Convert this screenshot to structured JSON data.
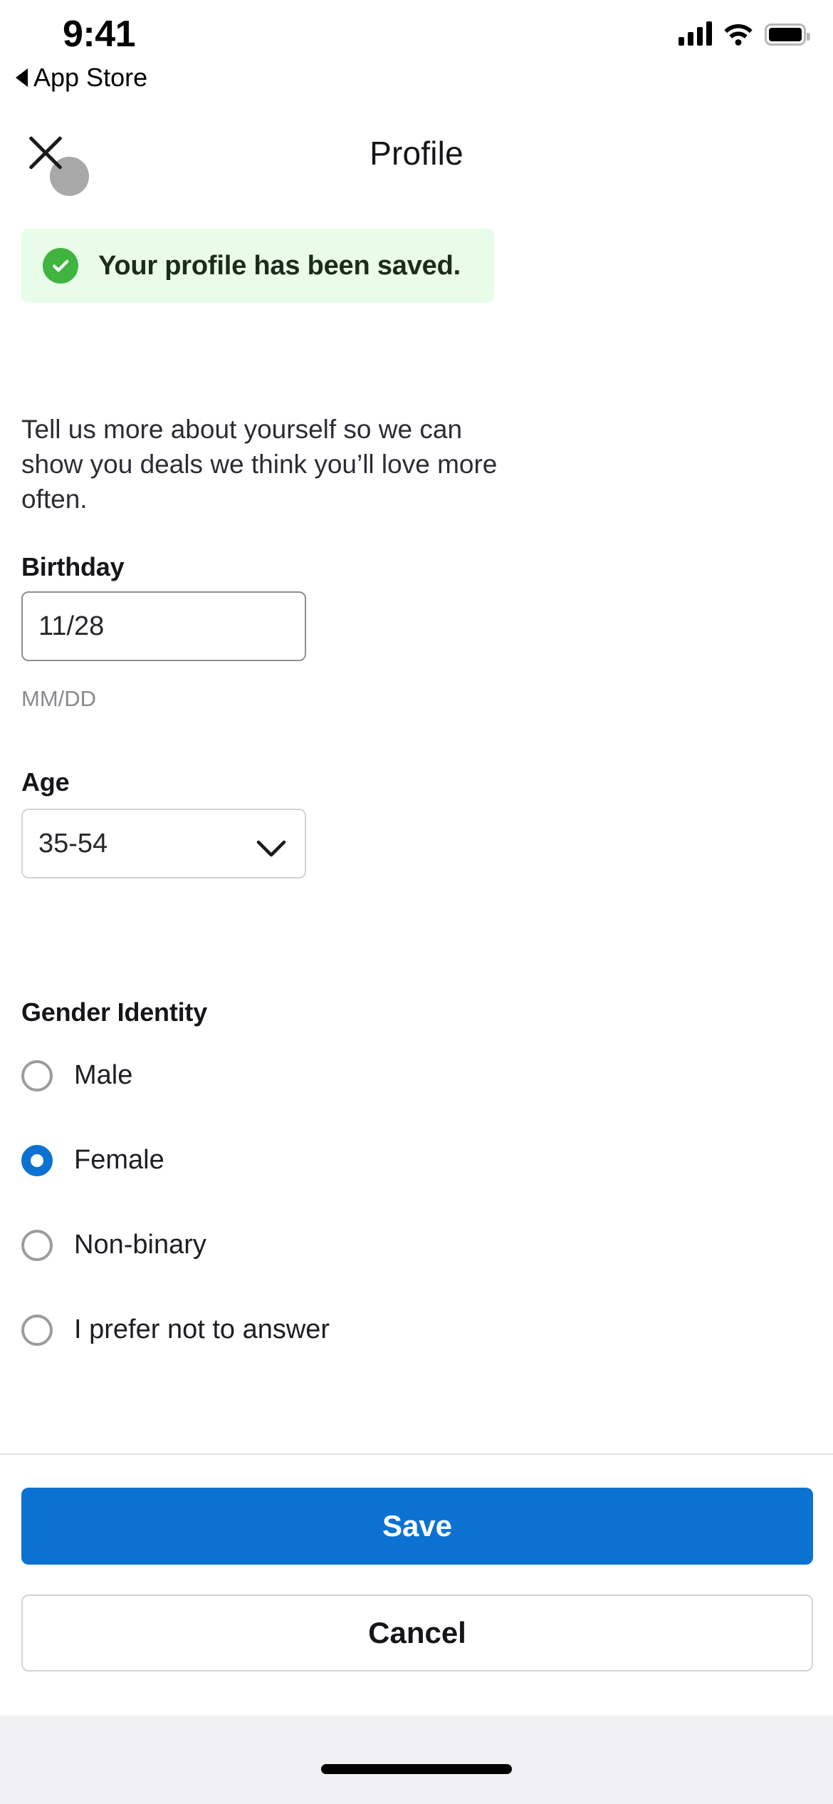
{
  "status_bar": {
    "time": "9:41",
    "back_app": "App Store",
    "icons": {
      "signal": "cellular-signal-icon",
      "wifi": "wifi-icon",
      "battery": "battery-full-icon"
    }
  },
  "header": {
    "close_icon": "close-x-icon",
    "title": "Profile"
  },
  "banner": {
    "icon": "check-circle-icon",
    "message": "Your profile has been saved.",
    "bg_color": "#e9fbe9",
    "icon_color": "#3fb53f",
    "text_color": "#1d2b1d"
  },
  "intro": {
    "text": "Tell us more about yourself so we can show you deals we think you’ll love more often."
  },
  "fields": {
    "birthday": {
      "label": "Birthday",
      "value": "11/28",
      "placeholder": "MM/DD",
      "hint": "MM/DD"
    },
    "age": {
      "label": "Age",
      "value": "35-54",
      "chevron_icon": "chevron-down-icon"
    },
    "gender": {
      "label": "Gender Identity",
      "selected": "Female",
      "accent_color": "#0b72d2",
      "options": [
        {
          "label": "Male",
          "checked": false
        },
        {
          "label": "Female",
          "checked": true
        },
        {
          "label": "Non-binary",
          "checked": false
        },
        {
          "label": "I prefer not to answer",
          "checked": false
        }
      ]
    }
  },
  "footer": {
    "save_label": "Save",
    "cancel_label": "Cancel",
    "save_color": "#0b72d2"
  },
  "home_indicator": "home-indicator"
}
